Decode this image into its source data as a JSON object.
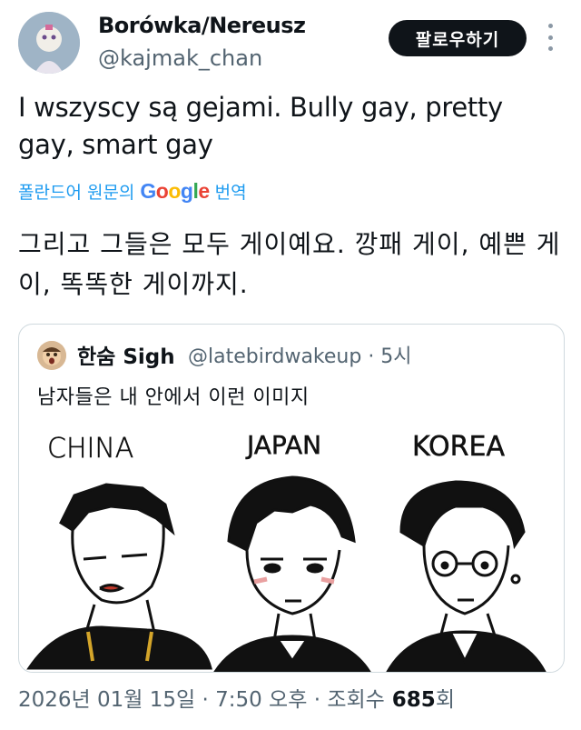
{
  "author": {
    "display_name": "Borówka/Nereusz",
    "handle": "@kajmak_chan"
  },
  "follow_button_label": "팔로우하기",
  "tweet": {
    "text": "I wszyscy są gejami. Bully gay, pretty gay, smart gay"
  },
  "translation": {
    "prefix": "폴란드어 원문의",
    "google": "Google",
    "suffix": "번역",
    "text": "그리고 그들은 모두 게이예요. 깡패 게이, 예쁜 게이, 똑똑한 게이까지."
  },
  "quoted": {
    "display_name": "한숨 Sigh",
    "handle_time": "@latebirdwakeup · 5시",
    "text": "남자들은 내 안에서 이런 이미지",
    "comic_labels": [
      "CHINA",
      "JAPAN",
      "KOREA"
    ]
  },
  "footer": {
    "timestamp": "2026년 01월 15일 · 7:50 오후 · 조회수",
    "views": "685",
    "views_suffix": "회"
  },
  "colors": {
    "link_blue": "#1d9bf0",
    "muted": "#536471",
    "follow_bg": "#0f1419"
  },
  "icons": [
    "more-options-icon",
    "avatar-image"
  ]
}
